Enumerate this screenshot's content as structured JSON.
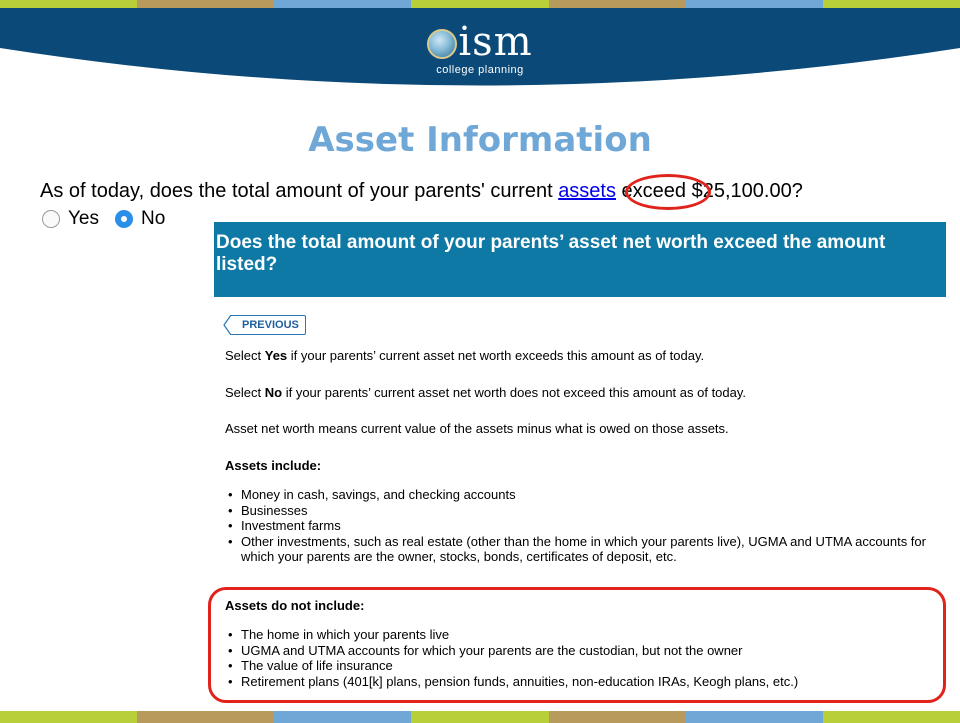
{
  "colors": {
    "header_dark": "#0b4a78",
    "title_blue": "#6fa8d6",
    "panel_blue": "#0f79a5",
    "highlight_red": "#e0241b",
    "stripe": [
      "#b8cf3a",
      "#b89a5c",
      "#6fa8d6",
      "#b8cf3a",
      "#b89a5c",
      "#6fa8d6",
      "#b8cf3a"
    ]
  },
  "logo": {
    "word": "ism",
    "subtitle": "college planning"
  },
  "slide_title": "Asset Information",
  "question": {
    "before": "As of today, does the total amount of your parents' current ",
    "link": "assets",
    "after": " exceed $25,100.00?"
  },
  "radios": {
    "yes_label": "Yes",
    "no_label": "No",
    "selected": "No"
  },
  "help_panel": {
    "heading": "Does the total amount of your parents’ asset net worth exceed the amount listed?",
    "previous_label": "PREVIOUS",
    "line_yes_prefix": "Select ",
    "line_yes_bold": "Yes",
    "line_yes_rest": " if your parents’ current asset net worth exceeds this amount as of today.",
    "line_no_prefix": "Select ",
    "line_no_bold": "No",
    "line_no_rest": " if your parents’ current asset net worth does not exceed this amount as of today.",
    "definition": "Asset net worth means current value of the assets minus what is owed on those assets.",
    "include_heading": "Assets include:",
    "include_items": [
      "Money in cash, savings, and checking accounts",
      "Businesses",
      "Investment farms",
      "Other investments, such as real estate (other than the home in which your parents live), UGMA and UTMA accounts for which your parents are the owner, stocks, bonds, certificates of deposit, etc."
    ],
    "exclude_heading": "Assets do not include:",
    "exclude_items": [
      "The home in which your parents live",
      "UGMA and UTMA accounts for which your parents are the custodian, but not the owner",
      "The value of life insurance",
      "Retirement plans (401[k] plans, pension funds, annuities, non-education IRAs, Keogh plans, etc.)"
    ]
  }
}
